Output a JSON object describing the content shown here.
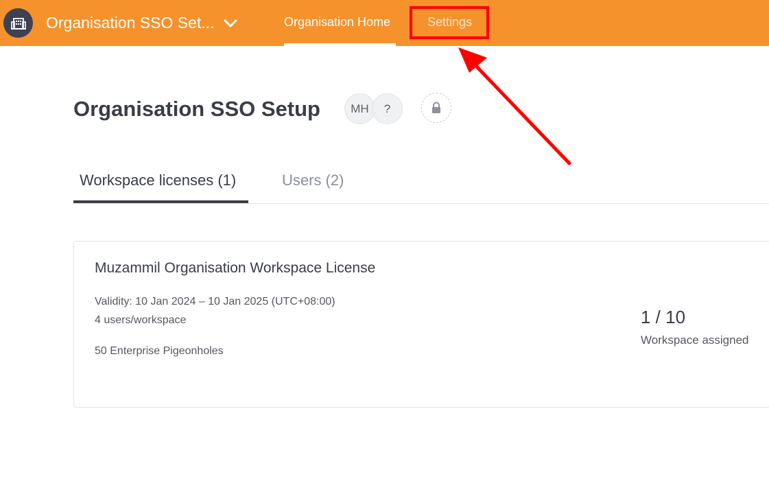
{
  "header": {
    "org_name": "Organisation SSO Set...",
    "logo_icon": "building-icon",
    "dropdown_icon": "chevron-down-icon",
    "nav": {
      "home_label": "Organisation Home",
      "settings_label": "Settings"
    },
    "bar_color": "#f5922b"
  },
  "annotation": {
    "highlight_color": "#ff0000"
  },
  "page": {
    "title": "Organisation SSO Setup",
    "avatars": [
      "MH",
      "?"
    ],
    "lock_icon": "lock-icon"
  },
  "tabs": {
    "licenses_label": "Workspace licenses (1)",
    "users_label": "Users (2)"
  },
  "license": {
    "name": "Muzammil Organisation Workspace License",
    "validity": "Validity: 10 Jan 2024 – 10 Jan 2025 (UTC+08:00)",
    "users_per_workspace": "4 users/workspace",
    "pigeonholes": "50 Enterprise Pigeonholes",
    "assigned_count": "1 / 10",
    "assigned_label": "Workspace assigned"
  }
}
